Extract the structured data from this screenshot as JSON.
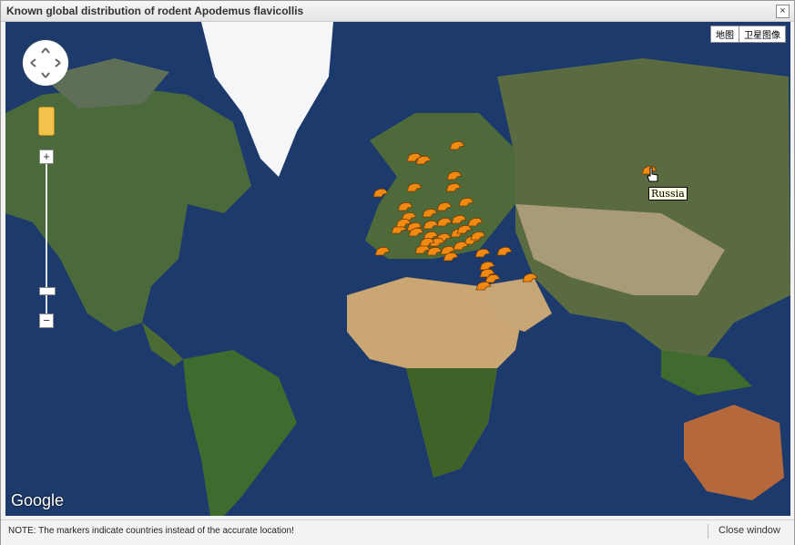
{
  "window": {
    "title": "Known global distribution of rodent Apodemus flavicollis",
    "close_glyph": "×"
  },
  "map": {
    "map_type_buttons": [
      "地图",
      "卫星图像"
    ],
    "zoom_in": "+",
    "zoom_out": "−",
    "attribution": "Google",
    "tooltip": "Russia",
    "marker_color": "#f08a12",
    "icons": [
      "pan-control-icon",
      "pegman-icon",
      "cursor-hand-icon",
      "marker-icon"
    ]
  },
  "status": {
    "note": "NOTE: The markers indicate countries instead of the accurate location!",
    "close_label": "Close window"
  }
}
